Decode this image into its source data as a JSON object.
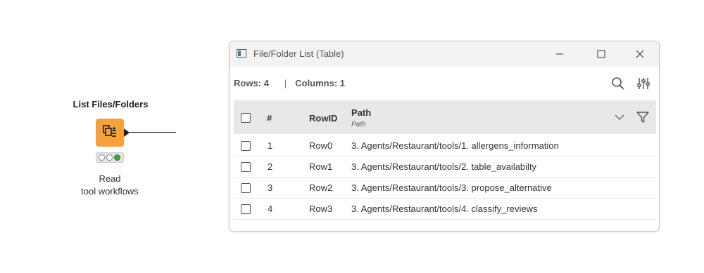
{
  "node": {
    "title": "List Files/Folders",
    "icon": "list-files-icon",
    "status": "executed-green",
    "label_line1": "Read",
    "label_line2": "tool workflows",
    "color": "#f7a13a"
  },
  "window": {
    "title": "File/Folder List (Table)",
    "stats": {
      "rows": "Rows: 4",
      "separator": "|",
      "columns": "Columns: 1"
    }
  },
  "table": {
    "headers": {
      "index": "#",
      "rowid": "RowID",
      "col": "Path",
      "col_type": "Path"
    },
    "rows": [
      {
        "num": "1",
        "id": "Row0",
        "path": "3. Agents/Restaurant/tools/1. allergens_information"
      },
      {
        "num": "2",
        "id": "Row1",
        "path": "3. Agents/Restaurant/tools/2. table_availabilty"
      },
      {
        "num": "3",
        "id": "Row2",
        "path": "3. Agents/Restaurant/tools/3. propose_alternative"
      },
      {
        "num": "4",
        "id": "Row3",
        "path": "3. Agents/Restaurant/tools/4. classify_reviews"
      }
    ]
  }
}
